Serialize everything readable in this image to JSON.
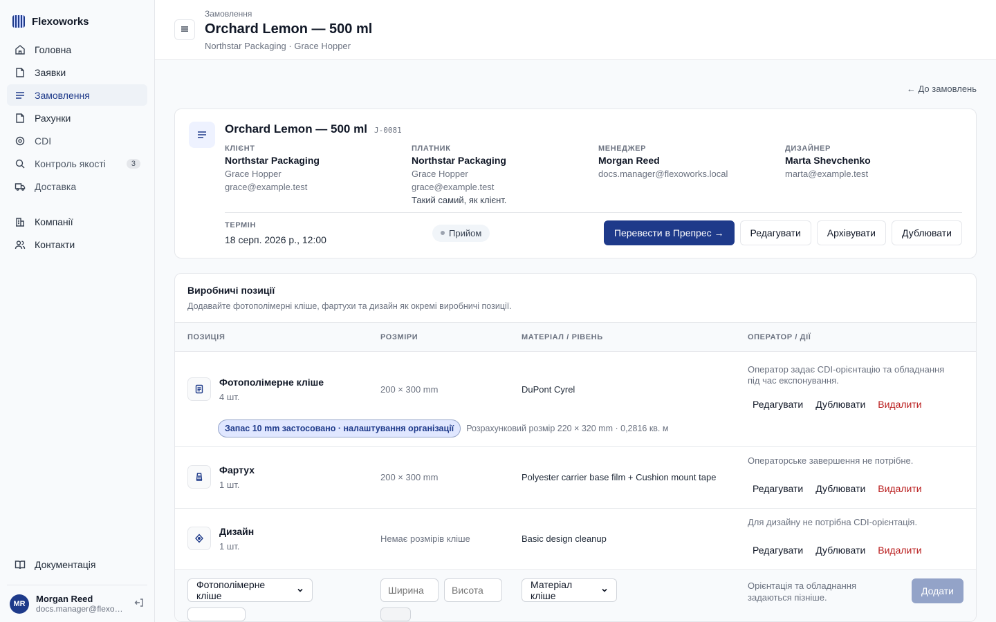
{
  "sidebar": {
    "brand": "Flexoworks",
    "items": [
      {
        "label": "Головна",
        "icon": "home-icon"
      },
      {
        "label": "Заявки",
        "icon": "inbox-icon"
      },
      {
        "label": "Замовлення",
        "icon": "list-icon",
        "active": true
      },
      {
        "label": "Рахунки",
        "icon": "document-icon"
      },
      {
        "label": "CDI",
        "icon": "target-icon"
      },
      {
        "label": "Контроль якості",
        "icon": "search-icon",
        "badge": "3"
      },
      {
        "label": "Доставка",
        "icon": "truck-icon"
      }
    ],
    "items2": [
      {
        "label": "Компанії",
        "icon": "building-icon"
      },
      {
        "label": "Контакти",
        "icon": "users-icon"
      }
    ],
    "docs": "Документація",
    "user": {
      "initials": "MR",
      "name": "Morgan Reed",
      "email": "docs.manager@flexoworks.local"
    }
  },
  "header": {
    "breadcrumb": "Замовлення",
    "title": "Orchard Lemon — 500 ml",
    "subtitle": "Northstar Packaging · Grace Hopper"
  },
  "back_link": "← До замовлень",
  "order": {
    "title": "Orchard Lemon — 500 ml",
    "code": "J-0081",
    "client": {
      "label": "КЛІЄНТ",
      "name": "Northstar Packaging",
      "contact": "Grace Hopper",
      "email": "grace@example.test"
    },
    "payer": {
      "label": "ПЛАТНИК",
      "name": "Northstar Packaging",
      "contact": "Grace Hopper",
      "email": "grace@example.test",
      "note": "Такий самий, як клієнт."
    },
    "manager": {
      "label": "МЕНЕДЖЕР",
      "name": "Morgan Reed",
      "email": "docs.manager@flexoworks.local"
    },
    "designer": {
      "label": "ДИЗАЙНЕР",
      "name": "Marta Shevchenko",
      "email": "marta@example.test"
    },
    "term_label": "ТЕРМІН",
    "term_value": "18 серп. 2026 р., 12:00",
    "status": "Прийом",
    "actions": {
      "primary": "Перевести в Препрес →",
      "edit": "Редагувати",
      "archive": "Архівувати",
      "duplicate": "Дублювати"
    }
  },
  "production": {
    "title": "Виробничі позиції",
    "description": "Додавайте фотополімерні кліше, фартухи та дизайн як окремі виробничі позиції.",
    "columns": [
      "ПОЗИЦІЯ",
      "РОЗМІРИ",
      "МАТЕРІАЛ / РІВЕНЬ",
      "ОПЕРАТОР / ДІЇ"
    ],
    "rows": [
      {
        "name": "Фотополімерне кліше",
        "qty": "4 шт.",
        "size": "200 × 300 mm",
        "material": "DuPont Cyrel",
        "note": "Оператор задає CDI-орієнтацію та обладнання під час експонування.",
        "pill": "Запас 10 mm застосовано · налаштування організації",
        "calc": "Розрахунковий розмір 220 × 320 mm · 0,2816 кв. м"
      },
      {
        "name": "Фартух",
        "qty": "1 шт.",
        "size": "200 × 300 mm",
        "material": "Polyester carrier base film + Cushion mount tape",
        "note": "Операторське завершення не потрібне."
      },
      {
        "name": "Дизайн",
        "qty": "1 шт.",
        "size": "Немає розмірів кліше",
        "material": "Basic design cleanup",
        "note": "Для дизайну не потрібна CDI-орієнтація."
      }
    ],
    "row_actions": {
      "edit": "Редагувати",
      "duplicate": "Дублювати",
      "delete": "Видалити"
    },
    "add": {
      "type_value": "Фотополімерне кліше",
      "width_placeholder": "Ширина",
      "height_placeholder": "Висота",
      "material_value": "Матеріал кліше",
      "note": "Орієнтація та обладнання задаються пізніше.",
      "button": "Додати"
    }
  }
}
